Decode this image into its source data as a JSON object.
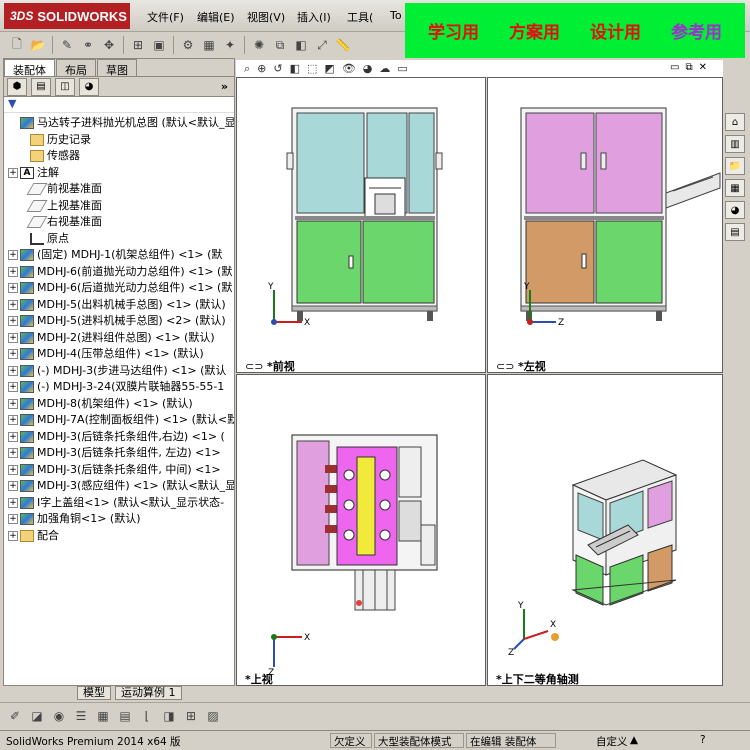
{
  "app": {
    "logo_prefix": "3DS",
    "logo_text": "SOLIDWORKS"
  },
  "menu": [
    "文件(F)",
    "编辑(E)",
    "视图(V)",
    "插入(I)",
    "工具(",
    "To"
  ],
  "banner": [
    "学习用",
    "方案用",
    "设计用",
    "参考用"
  ],
  "colors": {
    "banner_bg": "#00ee33",
    "banner_red": "#e21010",
    "banner_purple": "#9933cc",
    "logo_red": "#b32024",
    "panel_green": "#6bd66b",
    "panel_teal": "#a8d8d8",
    "panel_magenta": "#e0a0e0",
    "panel_brown": "#d19a66"
  },
  "panel": {
    "tabs": [
      "装配体",
      "布局",
      "草图"
    ],
    "collapse": "»",
    "filter": "▼"
  },
  "tree": [
    {
      "indent": 0,
      "exp": "",
      "icon": "asm",
      "text": "马达转子进料抛光机总图 (默认<默认_显"
    },
    {
      "indent": 1,
      "exp": "",
      "icon": "folder",
      "text": "历史记录"
    },
    {
      "indent": 1,
      "exp": "",
      "icon": "folder",
      "text": "传感器"
    },
    {
      "indent": 0,
      "exp": "+",
      "icon": "note",
      "text": "注解"
    },
    {
      "indent": 1,
      "exp": "",
      "icon": "plane",
      "text": "前视基准面"
    },
    {
      "indent": 1,
      "exp": "",
      "icon": "plane",
      "text": "上视基准面"
    },
    {
      "indent": 1,
      "exp": "",
      "icon": "plane",
      "text": "右视基准面"
    },
    {
      "indent": 1,
      "exp": "",
      "icon": "origin",
      "text": "原点"
    },
    {
      "indent": 0,
      "exp": "+",
      "icon": "asm",
      "text": "(固定) MDHJ-1(机架总组件) <1> (默"
    },
    {
      "indent": 0,
      "exp": "+",
      "icon": "asm",
      "text": "MDHJ-6(前道抛光动力总组件) <1> (默"
    },
    {
      "indent": 0,
      "exp": "+",
      "icon": "asm",
      "text": "MDHJ-6(后道抛光动力总组件) <1> (默"
    },
    {
      "indent": 0,
      "exp": "+",
      "icon": "asm",
      "text": "MDHJ-5(出料机械手总图) <1> (默认)"
    },
    {
      "indent": 0,
      "exp": "+",
      "icon": "asm",
      "text": "MDHJ-5(进料机械手总图) <2> (默认)"
    },
    {
      "indent": 0,
      "exp": "+",
      "icon": "asm",
      "text": "MDHJ-2(进料组件总图) <1> (默认)"
    },
    {
      "indent": 0,
      "exp": "+",
      "icon": "asm",
      "text": "MDHJ-4(压带总组件) <1> (默认)"
    },
    {
      "indent": 0,
      "exp": "+",
      "icon": "asm",
      "text": "(-) MDHJ-3(步进马达组件) <1> (默认"
    },
    {
      "indent": 0,
      "exp": "+",
      "icon": "asm",
      "text": "(-) MDHJ-3-24(双膜片联轴器55-55-1"
    },
    {
      "indent": 0,
      "exp": "+",
      "icon": "asm",
      "text": "MDHJ-8(机架组件) <1> (默认)"
    },
    {
      "indent": 0,
      "exp": "+",
      "icon": "asm",
      "text": "MDHJ-7A(控制面板组件) <1> (默认<默"
    },
    {
      "indent": 0,
      "exp": "+",
      "icon": "asm",
      "text": "MDHJ-3(后链条托条组件,右边) <1> ("
    },
    {
      "indent": 0,
      "exp": "+",
      "icon": "asm",
      "text": "MDHJ-3(后链条托条组件, 左边) <1>"
    },
    {
      "indent": 0,
      "exp": "+",
      "icon": "asm",
      "text": "MDHJ-3(后链条托条组件, 中间) <1>"
    },
    {
      "indent": 0,
      "exp": "+",
      "icon": "asm",
      "text": "MDHJ-3(感应组件) <1> (默认<默认_显"
    },
    {
      "indent": 0,
      "exp": "+",
      "icon": "asm",
      "text": "I字上盖组<1> (默认<默认_显示状态-"
    },
    {
      "indent": 0,
      "exp": "+",
      "icon": "asm",
      "text": "加强角铜<1> (默认)"
    },
    {
      "indent": 0,
      "exp": "+",
      "icon": "folder",
      "text": "配合"
    }
  ],
  "bottom_tabs": [
    "模型",
    "运动算例 1"
  ],
  "viewports": {
    "front": "*前视",
    "left": "*左视",
    "top": "*上视",
    "iso": "*上下二等角轴测"
  },
  "axes": {
    "x": "X",
    "y": "Y",
    "z": "Z"
  },
  "status": {
    "product": "SolidWorks Premium 2014 x64 版",
    "under_defined": "欠定义",
    "mode": "大型装配体模式",
    "editing": "在编辑 装配体",
    "custom": "自定义"
  }
}
